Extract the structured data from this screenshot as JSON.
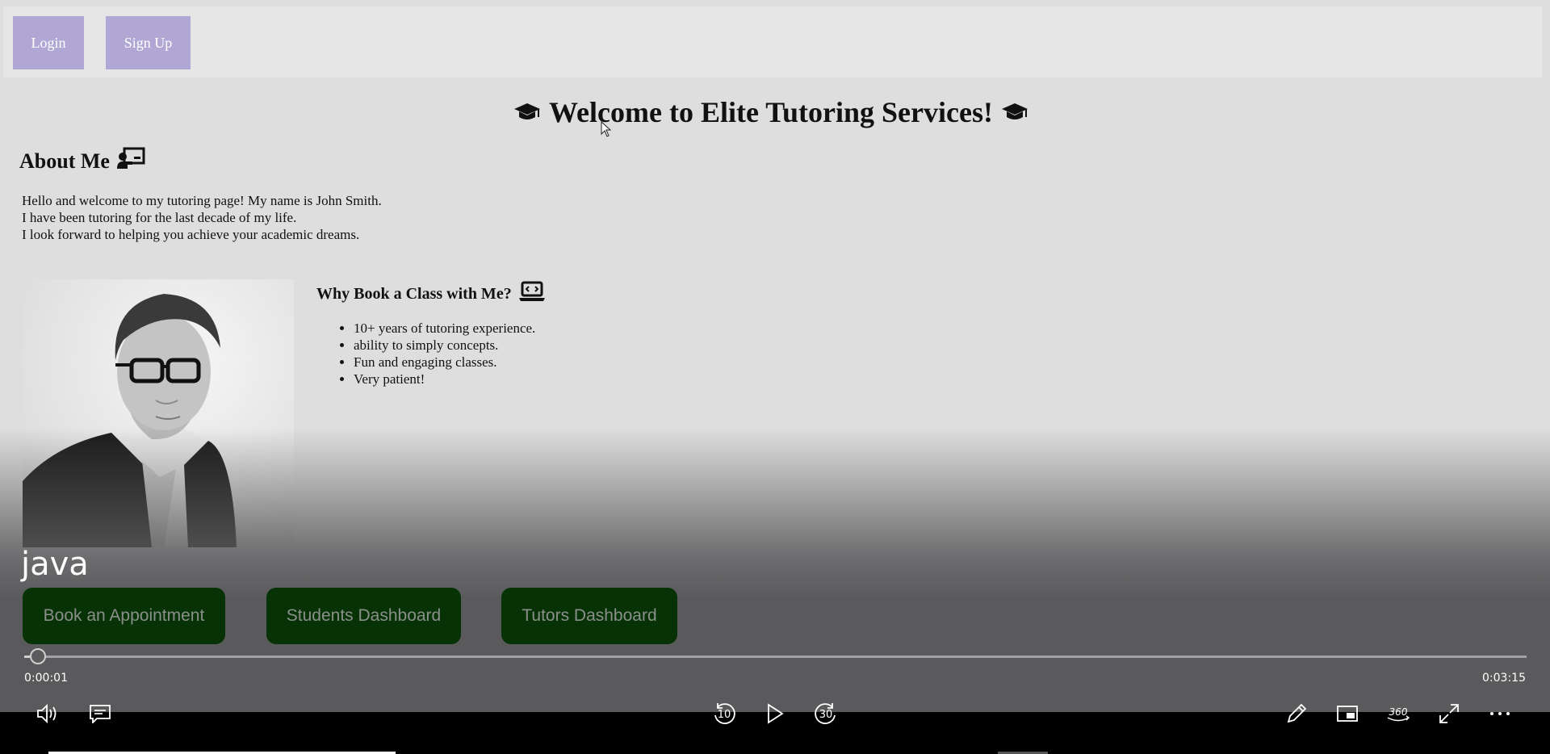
{
  "header": {
    "login_label": "Login",
    "signup_label": "Sign Up"
  },
  "main": {
    "title": "Welcome to Elite Tutoring Services!",
    "about_heading": "About Me",
    "about_lines": [
      "Hello and welcome to my tutoring page! My name is John Smith.",
      "I have been tutoring for the last decade of my life.",
      "I look forward to helping you achieve your academic dreams."
    ],
    "why_heading": "Why Book a Class with Me?",
    "why_items": [
      "10+ years of tutoring experience.",
      "ability to simply concepts.",
      "Fun and engaging classes.",
      "Very patient!"
    ],
    "buttons": {
      "book": "Book an Appointment",
      "students": "Students Dashboard",
      "tutors": "Tutors Dashboard"
    }
  },
  "player": {
    "video_title": "java",
    "current_time": "0:00:01",
    "total_time": "0:03:15",
    "progress_fraction": 0.005,
    "rewind_seconds": "10",
    "forward_seconds": "30",
    "view_360_label": "360",
    "controls": [
      "volume-icon",
      "captions-icon",
      "rewind-10-icon",
      "play-icon",
      "forward-30-icon",
      "pen-icon",
      "mini-view-icon",
      "view-360-icon",
      "fullscreen-icon",
      "more-icon"
    ]
  },
  "colors": {
    "page_bg": "#dfdedf",
    "topbar_bg": "#e7e6e7",
    "top_button_bg": "#b1a7d4",
    "nav_button_bg": "#063206",
    "nav_button_text": "#8a8f8a",
    "player_bg": "#5a5a5c"
  }
}
